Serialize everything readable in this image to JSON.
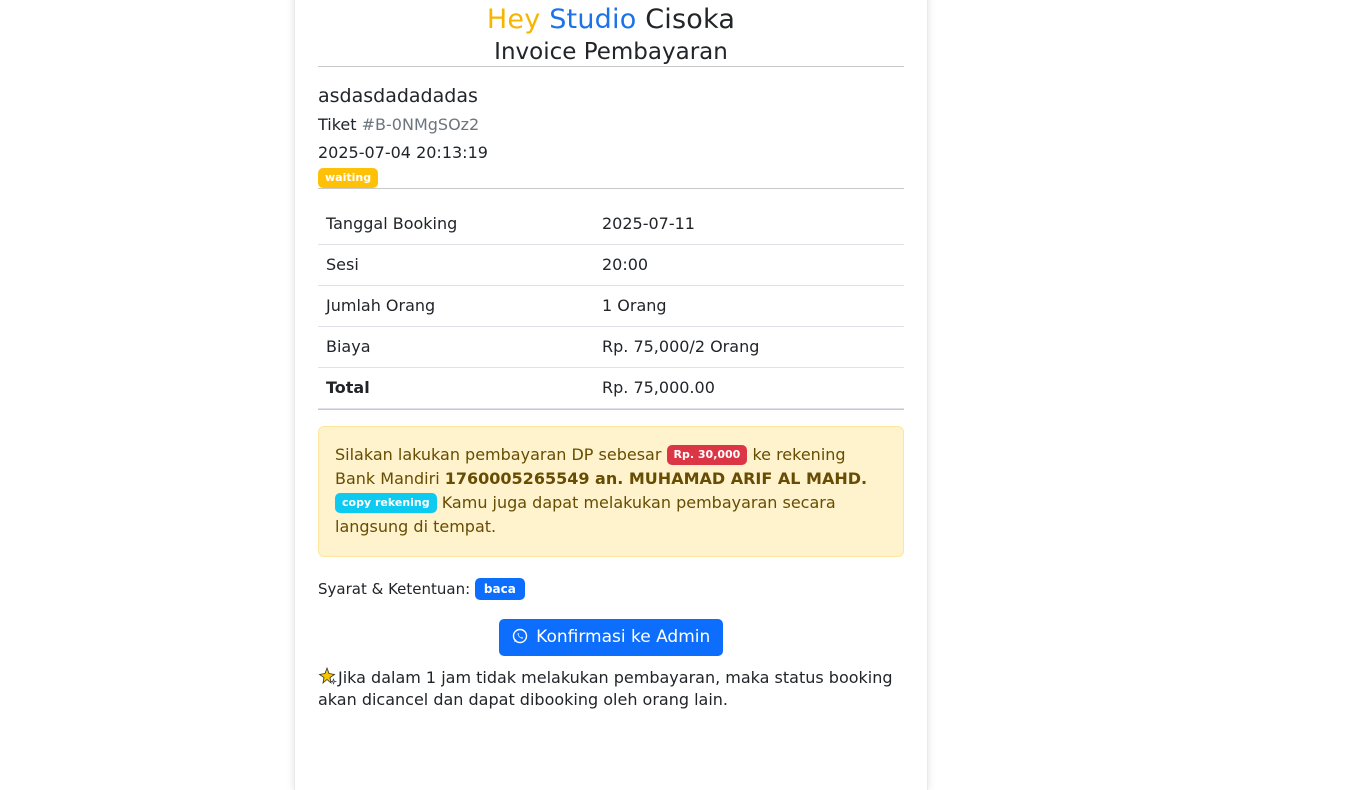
{
  "brand": {
    "word1": "Hey",
    "word2": "Studio",
    "word3": "Cisoka",
    "subtitle": "Invoice Pembayaran",
    "colors": {
      "hey": "#f7b500",
      "studio": "#1a73e8"
    }
  },
  "customer": {
    "name": "asdasdadadadas",
    "ticket_label": "Tiket",
    "ticket_id": "#B-0NMgSOz2",
    "datetime": "2025-07-04 20:13:19",
    "status": "waiting"
  },
  "details": [
    {
      "key": "Tanggal Booking",
      "value": "2025-07-11"
    },
    {
      "key": "Sesi",
      "value": "20:00"
    },
    {
      "key": "Jumlah Orang",
      "value": "1 Orang"
    },
    {
      "key": "Biaya",
      "value": "Rp. 75,000/2 Orang"
    },
    {
      "key": "Total",
      "value": "Rp. 75,000.00"
    }
  ],
  "payment": {
    "text1": "Silakan lakukan pembayaran DP sebesar",
    "dp_amount": "Rp. 30,000",
    "text2": "ke rekening Bank Mandiri",
    "account": "1760005265549 an. MUHAMAD ARIF AL MAHD.",
    "copy_label": "copy rekening",
    "text3": "Kamu juga dapat melakukan pembayaran secara langsung di tempat."
  },
  "terms": {
    "label": "Syarat & Ketentuan:",
    "read_label": "baca"
  },
  "confirm": {
    "label": "Konfirmasi ke Admin",
    "icon": "whatsapp-icon"
  },
  "note": {
    "icon": "sparkle-icon",
    "text": "Jika dalam 1 jam tidak melakukan pembayaran, maka status booking akan dicancel dan dapat dibooking oleh orang lain."
  }
}
